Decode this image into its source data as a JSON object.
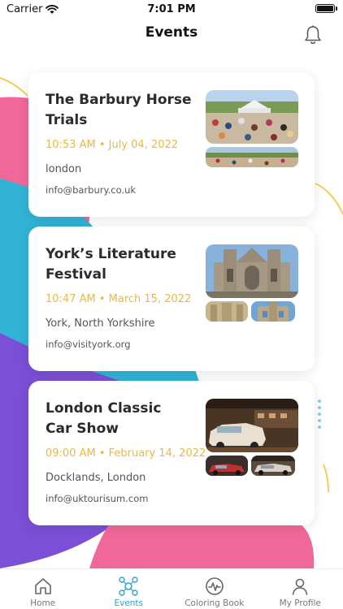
{
  "status_bar": {
    "carrier": "Carrier",
    "time": "7:01 PM"
  },
  "header": {
    "title": "Events",
    "bell_icon": "bell-icon"
  },
  "events": [
    {
      "title": "The Barbury Horse Trials",
      "datetime": "10:53 AM • July 04, 2022",
      "location": "london",
      "email": "info@barbury.co.uk"
    },
    {
      "title": "York’s Literature Festival",
      "datetime": "10:47 AM • March 15, 2022",
      "location": "York, North Yorkshire",
      "email": "info@visityork.org"
    },
    {
      "title": "London Classic Car Show",
      "datetime": "09:00 AM • February 14, 2022",
      "location": "Docklands, London",
      "email": "info@uktourisum.com"
    }
  ],
  "tabs": [
    {
      "label": "Home",
      "icon": "home-icon",
      "active": false
    },
    {
      "label": "Events",
      "icon": "events-icon",
      "active": true
    },
    {
      "label": "Coloring Book",
      "icon": "coloring-book-icon",
      "active": false
    },
    {
      "label": "My Profile",
      "icon": "profile-icon",
      "active": false
    }
  ],
  "colors": {
    "accent": "#2aa2d6",
    "date": "#e8b84a",
    "pink": "#f0689a",
    "cyan": "#31b3d6",
    "purple": "#7b4fd6",
    "yellow_line": "#f2cc55"
  }
}
